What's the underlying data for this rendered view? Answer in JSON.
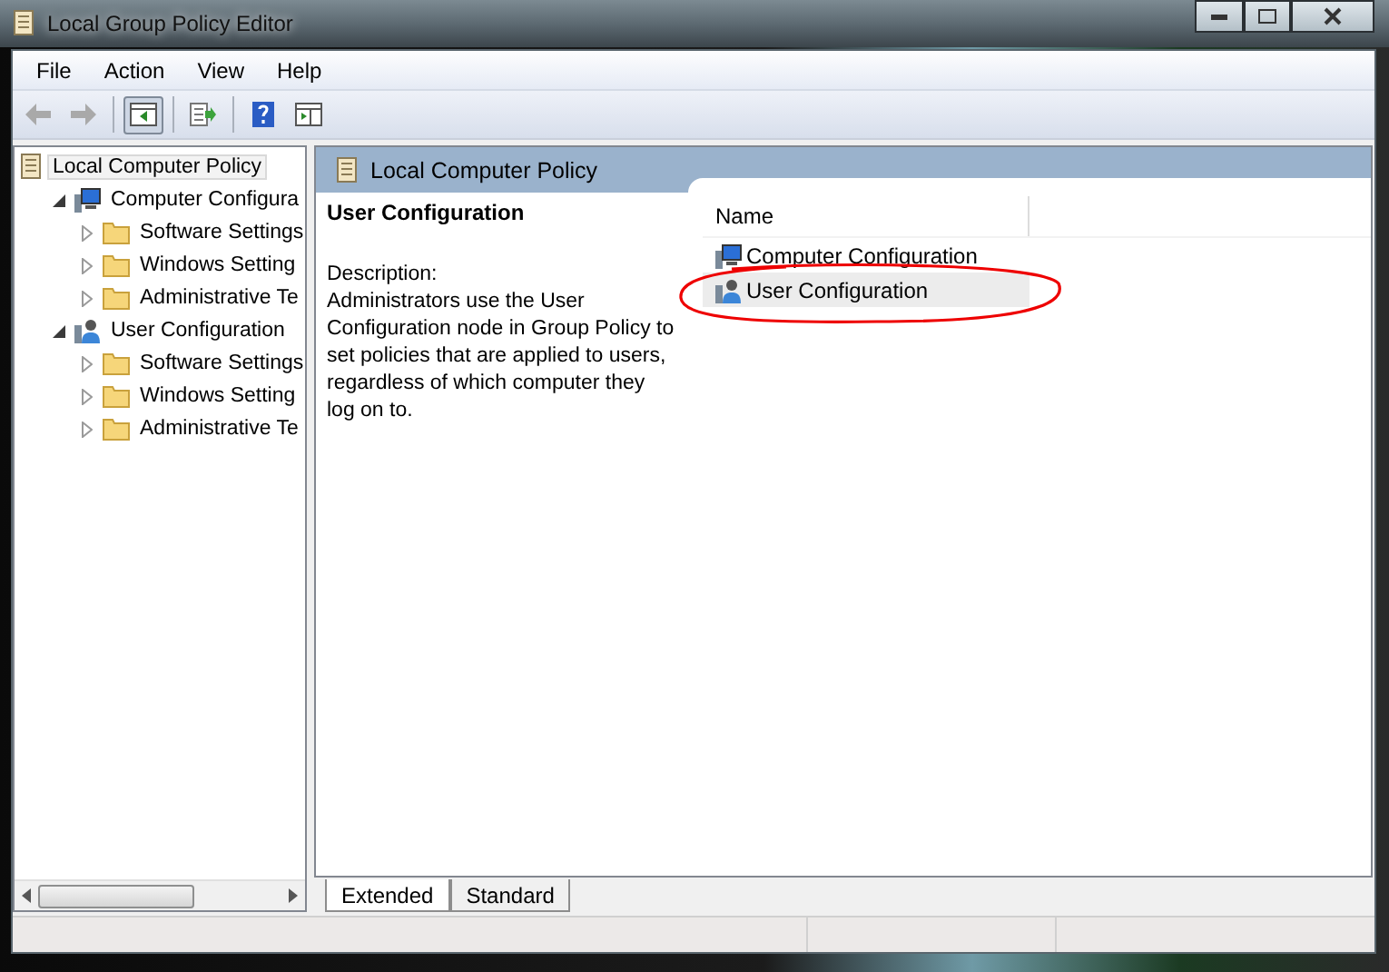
{
  "window": {
    "title": "Local Group Policy Editor"
  },
  "menu": [
    "File",
    "Action",
    "View",
    "Help"
  ],
  "toolbar": [
    {
      "kind": "back",
      "disabled": true
    },
    {
      "kind": "forward",
      "disabled": true
    },
    {
      "kind": "sep"
    },
    {
      "kind": "tree",
      "pressed": true
    },
    {
      "kind": "sep"
    },
    {
      "kind": "export",
      "pressed": false
    },
    {
      "kind": "sep"
    },
    {
      "kind": "help",
      "pressed": false
    },
    {
      "kind": "pane",
      "pressed": false
    }
  ],
  "tree": [
    {
      "label": "Local Computer Policy",
      "kind": "policy",
      "selected": true,
      "children": [
        {
          "label": "Computer Configura",
          "kind": "computer",
          "selected": false,
          "expanded": true,
          "children": [
            {
              "label": "Software Settings",
              "kind": "folder",
              "selected": false,
              "expanded": false
            },
            {
              "label": "Windows Setting",
              "kind": "folder",
              "selected": false,
              "expanded": false
            },
            {
              "label": "Administrative Te",
              "kind": "folder",
              "selected": false,
              "expanded": false
            }
          ]
        },
        {
          "label": "User Configuration",
          "kind": "user",
          "selected": false,
          "expanded": true,
          "children": [
            {
              "label": "Software Settings",
              "kind": "folder",
              "selected": false,
              "expanded": false
            },
            {
              "label": "Windows Setting",
              "kind": "folder",
              "selected": false,
              "expanded": false
            },
            {
              "label": "Administrative Te",
              "kind": "folder",
              "selected": false,
              "expanded": false
            }
          ]
        }
      ]
    }
  ],
  "details": {
    "header": "Local Computer Policy",
    "title": "User Configuration",
    "description_label": "Description:",
    "description": "Administrators use the User Configuration node in Group Policy to set policies that are applied to users, regardless of which computer they log on to."
  },
  "list": {
    "columns": [
      "Name"
    ],
    "rows": [
      {
        "name": "Computer Configuration",
        "kind": "computer",
        "selected": false
      },
      {
        "name": "User Configuration",
        "kind": "user",
        "selected": true
      }
    ]
  },
  "tabs": [
    {
      "label": "Extended",
      "selected": true
    },
    {
      "label": "Standard",
      "selected": false
    }
  ]
}
